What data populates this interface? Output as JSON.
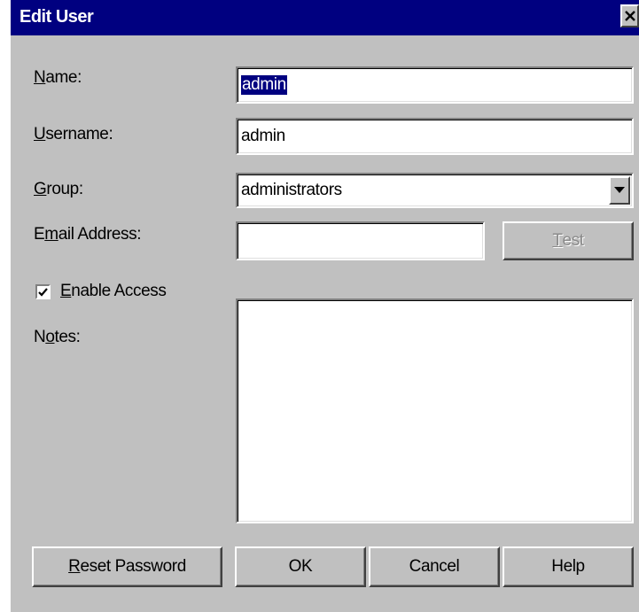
{
  "window": {
    "title": "Edit User",
    "close_glyph": "✕"
  },
  "form": {
    "name": {
      "label_accel": "N",
      "label_rest": "ame:",
      "value": "admin"
    },
    "username": {
      "label_accel": "U",
      "label_rest": "sername:",
      "value": "admin"
    },
    "group": {
      "label_accel": "G",
      "label_rest": "roup:",
      "value": "administrators"
    },
    "email": {
      "label_pre": "E",
      "label_accel": "m",
      "label_rest": "ail Address:",
      "value": "",
      "test_accel": "T",
      "test_rest": "est",
      "test_enabled": false
    },
    "enable_access": {
      "label_accel": "E",
      "label_rest": "nable Access",
      "checked": true
    },
    "notes": {
      "label_pre": "N",
      "label_accel": "o",
      "label_rest": "tes:",
      "value": ""
    }
  },
  "buttons": {
    "reset_password": {
      "accel": "R",
      "rest": "eset Password"
    },
    "ok": "OK",
    "cancel": "Cancel",
    "help": "Help"
  },
  "icons": {
    "close": "close-icon",
    "dropdown": "chevron-down-icon",
    "checkmark": "checkmark-icon"
  },
  "colors": {
    "titlebar": "#000080",
    "dialog_face": "#c0c0c0",
    "selection": "#000080"
  }
}
